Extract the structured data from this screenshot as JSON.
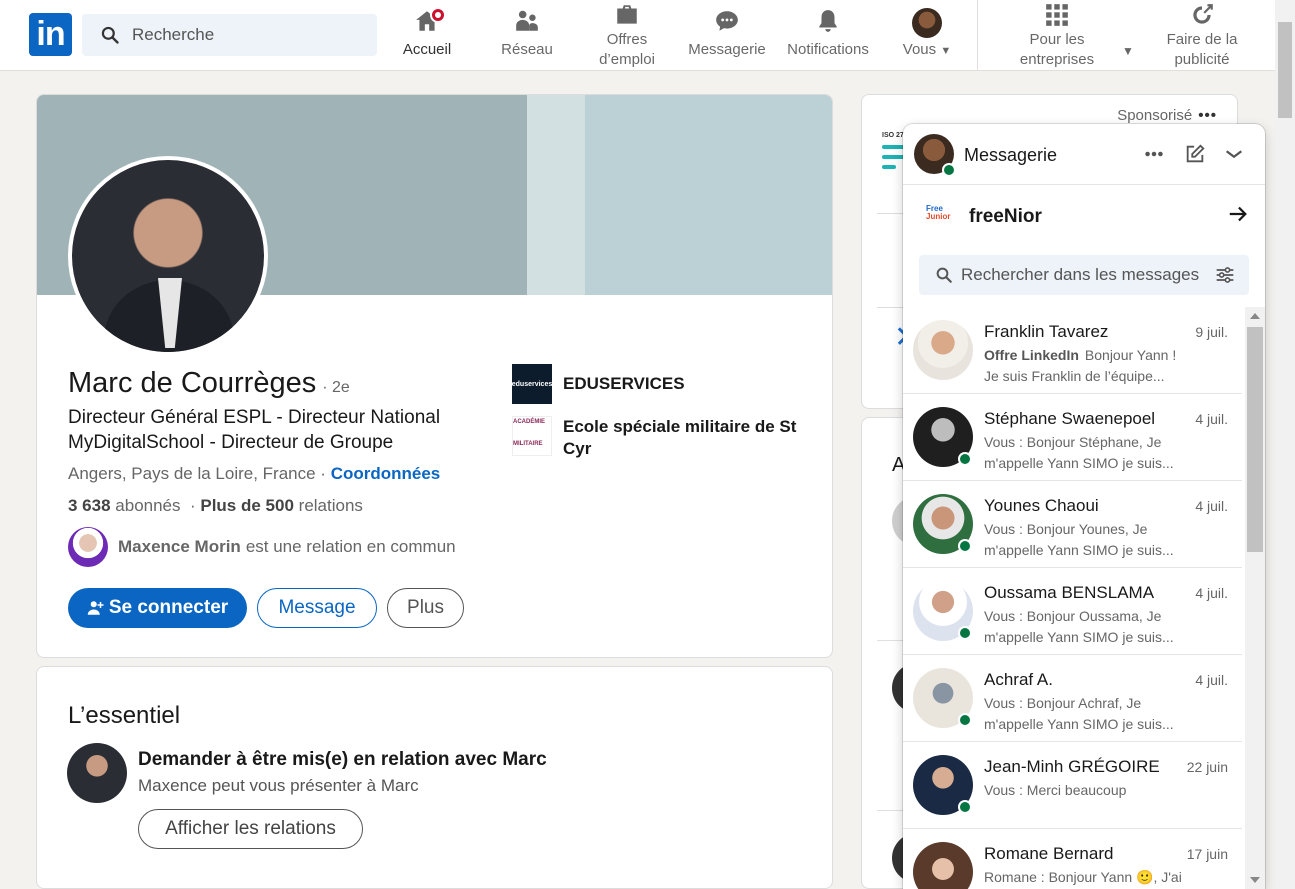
{
  "nav": {
    "logo": "in",
    "search_placeholder": "Recherche",
    "items": [
      {
        "label": "Accueil"
      },
      {
        "label": "Réseau"
      },
      {
        "label": "Offres d’emploi"
      },
      {
        "label": "Messagerie"
      },
      {
        "label": "Notifications"
      },
      {
        "label": "Vous"
      },
      {
        "label": "Pour les entreprises"
      },
      {
        "label": "Faire de la publicité"
      }
    ]
  },
  "profile": {
    "name": "Marc de Courrèges",
    "degree": "· 2e",
    "headline": "Directeur Général ESPL - Directeur National MyDigitalSchool - Directeur de Groupe",
    "location": "Angers, Pays de la Loire, France ·",
    "contact_link": "Coordonnées",
    "followers": "3 638",
    "followers_suffix": "abonnés",
    "relations": "Plus de 500",
    "relations_suffix": "relations",
    "mutual_name": "Maxence Morin",
    "mutual_text": "est une relation en commun",
    "connect_label": "Se connecter",
    "message_label": "Message",
    "more_label": "Plus",
    "orgs": [
      {
        "name": "EDUSERVICES",
        "logo_text": "eduservices"
      },
      {
        "name": "Ecole spéciale militaire de St Cyr",
        "logo_text": "ACADÉMIE MILITAIRE"
      }
    ]
  },
  "essentiel": {
    "title": "L’essentiel",
    "heading": "Demander à être mis(e) en relation avec Marc",
    "sub": "Maxence peut vous présenter à Marc",
    "button": "Afficher les relations"
  },
  "side": {
    "sponsored": "Sponsorisé",
    "ad_label": "ISO 27",
    "section_initial": "A"
  },
  "messaging": {
    "title": "Messagerie",
    "company_logo_top": "Free",
    "company_logo_bottom": "Junior",
    "company": "freeNior",
    "search_placeholder": "Rechercher dans les messages",
    "conversations": [
      {
        "name": "Franklin Tavarez",
        "date": "9 juil.",
        "tag": "Offre LinkedIn",
        "preview": "Bonjour Yann ! Je suis Franklin de l’équipe..."
      },
      {
        "name": "Stéphane Swaenepoel",
        "date": "4 juil.",
        "tag": "",
        "preview": "Vous : Bonjour Stéphane, Je m'appelle Yann SIMO je suis..."
      },
      {
        "name": "Younes Chaoui",
        "date": "4 juil.",
        "tag": "",
        "preview": "Vous : Bonjour Younes, Je m'appelle Yann SIMO je suis..."
      },
      {
        "name": "Oussama BENSLAMA",
        "date": "4 juil.",
        "tag": "",
        "preview": "Vous : Bonjour Oussama, Je m'appelle Yann SIMO je suis..."
      },
      {
        "name": "Achraf A.",
        "date": "4 juil.",
        "tag": "",
        "preview": "Vous : Bonjour Achraf, Je m'appelle Yann SIMO je suis..."
      },
      {
        "name": "Jean-Minh GRÉGOIRE",
        "date": "22 juin",
        "tag": "",
        "preview": "Vous : Merci beaucoup"
      },
      {
        "name": "Romane Bernard",
        "date": "17 juin",
        "tag": "",
        "preview": "Romane : Bonjour Yann 🙂, J'ai"
      }
    ]
  },
  "colors": {
    "brand": "#0a66c2",
    "online": "#057642",
    "badge": "#cb112d"
  }
}
